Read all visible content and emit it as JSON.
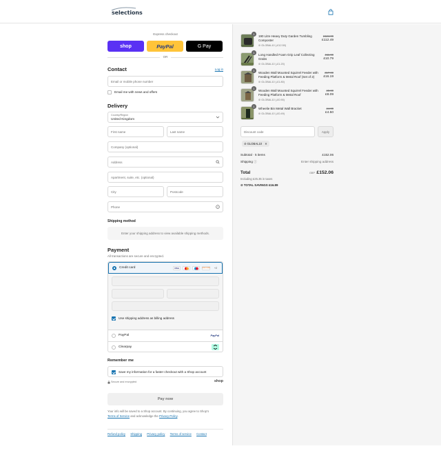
{
  "header": {
    "logo_text": "selections",
    "bag_icon": "bag-icon"
  },
  "express": {
    "title": "Express checkout",
    "shop": "shop",
    "paypal": "PayPal",
    "gpay": "G Pay",
    "or": "OR"
  },
  "contact": {
    "heading": "Contact",
    "login": "Log in",
    "email_placeholder": "Email or mobile phone number",
    "news_label": "Email me with news and offers"
  },
  "delivery": {
    "heading": "Delivery",
    "country_label": "Country/Region",
    "country_value": "United Kingdom",
    "first_name": "First name",
    "last_name": "Last name",
    "company": "Company (optional)",
    "address": "Address",
    "apartment": "Apartment, suite, etc. (optional)",
    "city": "City",
    "postcode": "Postcode",
    "phone": "Phone"
  },
  "shipping": {
    "heading": "Shipping method",
    "message": "Enter your shipping address to view available shipping methods."
  },
  "payment": {
    "heading": "Payment",
    "subtitle": "All transactions are secure and encrypted.",
    "credit_card": "Credit card",
    "card_brands": [
      "VISA",
      "MC",
      "DISCOVER",
      "+2"
    ],
    "billing_label": "Use shipping address as billing address",
    "paypal": "PayPal",
    "paypal_logo": "PayPal",
    "clearpay": "Clearpay"
  },
  "remember": {
    "heading": "Remember me",
    "label": "Save my information for a faster checkout with a Shop account",
    "secure": "Secure and encrypted",
    "shop_logo": "shop"
  },
  "pay_now": "Pay now",
  "legal": {
    "text1": "Your info will be saved to a Shop account. By continuing, you agree to Shop's",
    "terms": "Terms of Service",
    "text2": "and acknowledge the",
    "privacy": "Privacy Policy",
    "text3": "."
  },
  "footer": [
    "Refund policy",
    "Shipping",
    "Privacy policy",
    "Terms of service",
    "Contact"
  ],
  "order": {
    "items": [
      {
        "qty": "1",
        "name": "190 Litre Heavy Duty Garden Tumbling Composter",
        "discount": "GLOBAL10 (-£12.50)",
        "old": "£124.99",
        "price": "£112.49"
      },
      {
        "qty": "1",
        "name": "Long Handled Foam Grip Leaf Collecting Grabs",
        "discount": "GLOBAL10 (-£1.20)",
        "old": "£11.99",
        "price": "£10.79"
      },
      {
        "qty": "1",
        "name": "Wooden Wall Mounted Squirrel Feeder with Feeding Platform & Metal Roof (Set of 2)",
        "discount": "GLOBAL10 (-£1.80)",
        "old": "£17.99",
        "price": "£16.19"
      },
      {
        "qty": "1",
        "name": "Wooden Wall Mounted Squirrel Feeder with Feeding Platform & Metal Roof",
        "discount": "GLOBAL10 (-£0.90)",
        "old": "£8.99",
        "price": "£8.09"
      },
      {
        "qty": "1",
        "name": "Wheelie Bin Metal Wall Bracket",
        "discount": "GLOBAL10 (-£0.49)",
        "old": "£4.99",
        "price": "£4.50"
      }
    ],
    "discount_placeholder": "Discount code",
    "apply": "Apply",
    "chip": "GLOBAL10",
    "subtotal_label": "Subtotal · 5 items",
    "subtotal_value": "£152.06",
    "shipping_label": "Shipping",
    "shipping_value": "Enter shipping address",
    "total_label": "Total",
    "currency": "GBP",
    "total_value": "£152.06",
    "taxes": "Including £25.35 in taxes",
    "savings_label": "TOTAL SAVINGS",
    "savings_value": "£16.89"
  }
}
